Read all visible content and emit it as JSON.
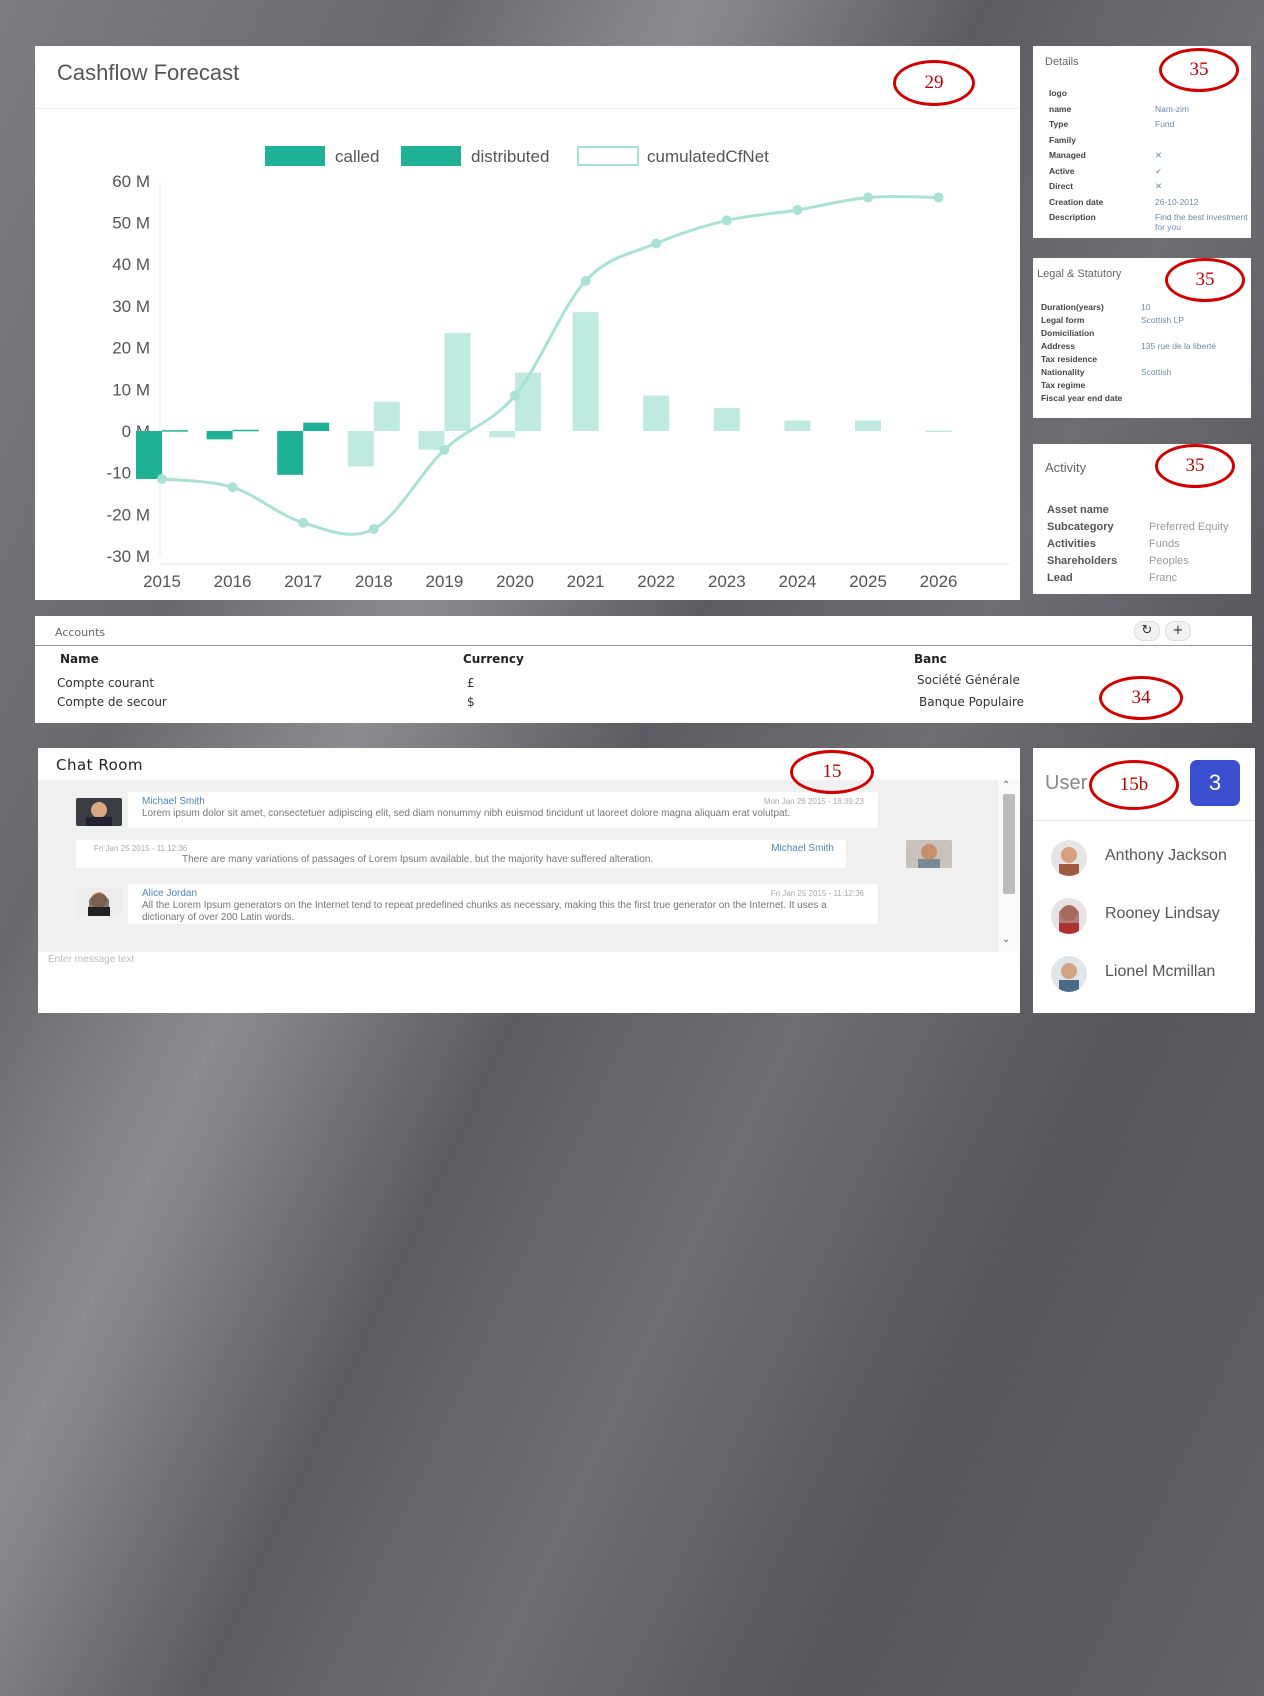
{
  "cashflow": {
    "title": "Cashflow Forecast",
    "annotation": "29"
  },
  "chart_data": {
    "type": "bar",
    "categories": [
      "2015",
      "2016",
      "2017",
      "2018",
      "2019",
      "2020",
      "2021",
      "2022",
      "2023",
      "2024",
      "2025",
      "2026"
    ],
    "series": [
      {
        "name": "called",
        "type": "bar",
        "color": "#1fb196",
        "values": [
          -11.5,
          -2,
          -10.5,
          -8.5,
          -4.5,
          -1.5,
          0,
          0,
          0,
          0,
          0,
          0
        ]
      },
      {
        "name": "distributed",
        "type": "bar",
        "color": "#1fb196",
        "values": [
          0.2,
          0.3,
          2,
          7,
          23.5,
          14,
          28.5,
          8.5,
          5.5,
          2.5,
          2.5,
          0.1
        ]
      },
      {
        "name": "cumulatedCfNet",
        "type": "line",
        "color": "#a9e2d5",
        "values": [
          -11.5,
          -13.5,
          -22,
          -23.5,
          -4.5,
          8.5,
          36,
          45,
          50.5,
          53,
          56,
          56
        ]
      }
    ],
    "yticks": [
      "60 M",
      "50 M",
      "40 M",
      "30 M",
      "20 M",
      "10 M",
      "0 M",
      "-10 M",
      "-20 M",
      "-30 M"
    ],
    "ylim": [
      -30,
      60
    ],
    "grid": false,
    "legend": "top"
  },
  "details": {
    "title": "Details",
    "annotation": "35",
    "rows": [
      {
        "key": "logo",
        "value": ""
      },
      {
        "key": "name",
        "value": "Nam-zim"
      },
      {
        "key": "Type",
        "value": "Fund"
      },
      {
        "key": "Family",
        "value": ""
      },
      {
        "key": "Managed",
        "value": "✕"
      },
      {
        "key": "Active",
        "value": "✓"
      },
      {
        "key": "Direct",
        "value": "✕"
      },
      {
        "key": "Creation date",
        "value": "26-10-2012"
      },
      {
        "key": "Description",
        "value": "Find the best investment for you"
      }
    ]
  },
  "legal": {
    "title": "Legal & Statutory",
    "annotation": "35",
    "rows": [
      {
        "key": "Duration(years)",
        "value": "10"
      },
      {
        "key": "Legal form",
        "value": "Scottish LP"
      },
      {
        "key": "Domiciliation",
        "value": ""
      },
      {
        "key": "Address",
        "value": "135 rue de la liberté"
      },
      {
        "key": "Tax residence",
        "value": ""
      },
      {
        "key": "Nationality",
        "value": "Scottish"
      },
      {
        "key": "Tax regime",
        "value": ""
      },
      {
        "key": "Fiscal year end date",
        "value": ""
      }
    ]
  },
  "activity": {
    "title": "Activity",
    "annotation": "35",
    "rows": [
      {
        "key": "Asset name",
        "value": ""
      },
      {
        "key": "Subcategory",
        "value": "Preferred Equity"
      },
      {
        "key": "Activities",
        "value": "Funds"
      },
      {
        "key": "Shareholders",
        "value": "Peoples"
      },
      {
        "key": "Lead",
        "value": "Franc"
      }
    ]
  },
  "accounts": {
    "title": "Accounts",
    "annotation": "34",
    "refresh_icon": "↻",
    "add_icon": "+",
    "columns": [
      "Name",
      "Currency",
      "Banc"
    ],
    "rows": [
      [
        "Compte courant",
        "£",
        "Société Générale"
      ],
      [
        "Compte de secour",
        "$",
        "Banque Populaire"
      ]
    ]
  },
  "chat": {
    "title": "Chat Room",
    "annotation": "15",
    "input_placeholder": "Enter message text",
    "messages": [
      {
        "name": "Michael Smith",
        "time": "Mon Jan 26 2015 - 18:39:23",
        "text": "Lorem ipsum dolor sit amet, consectetuer adipiscing elit, sed diam nonummy nibh euismod tincidunt ut laoreet dolore magna aliquam erat volutpat."
      },
      {
        "name": "Michael Smith",
        "time": "Fri Jan 25 2015 - 11:12:36",
        "text": "There are many variations of passages of Lorem Ipsum available, but the majority have suffered alteration."
      },
      {
        "name": "Alice Jordan",
        "time": "Fri Jan 25 2015 - 11:12:36",
        "text": "All the Lorem Ipsum generators on the Internet tend to repeat predefined chunks as necessary, making this the first true generator on the Internet. It uses a dictionary of over 200 Latin words."
      }
    ]
  },
  "users": {
    "title": "User",
    "annotation": "15b",
    "count": "3",
    "list": [
      {
        "name": "Anthony Jackson"
      },
      {
        "name": "Rooney Lindsay"
      },
      {
        "name": "Lionel Mcmillan"
      }
    ]
  }
}
